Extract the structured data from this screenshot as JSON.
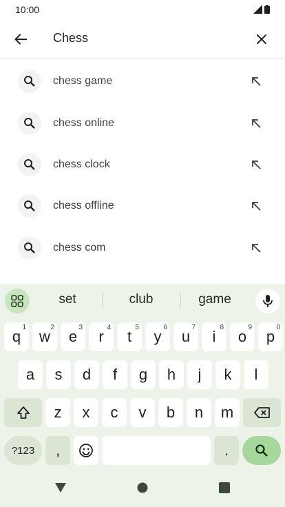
{
  "status_bar": {
    "time": "10:00"
  },
  "search": {
    "query": "Chess"
  },
  "suggestions": [
    {
      "text": "chess game"
    },
    {
      "text": "chess online"
    },
    {
      "text": "chess clock"
    },
    {
      "text": "chess offline"
    },
    {
      "text": "chess com"
    }
  ],
  "keyboard": {
    "suggestions": [
      "set",
      "club",
      "game"
    ],
    "row1": [
      {
        "key": "q",
        "alt": "1"
      },
      {
        "key": "w",
        "alt": "2"
      },
      {
        "key": "e",
        "alt": "3"
      },
      {
        "key": "r",
        "alt": "4"
      },
      {
        "key": "t",
        "alt": "5"
      },
      {
        "key": "y",
        "alt": "6"
      },
      {
        "key": "u",
        "alt": "7"
      },
      {
        "key": "i",
        "alt": "8"
      },
      {
        "key": "o",
        "alt": "9"
      },
      {
        "key": "p",
        "alt": "0"
      }
    ],
    "row2": [
      "a",
      "s",
      "d",
      "f",
      "g",
      "h",
      "j",
      "k",
      "l"
    ],
    "row3": [
      "z",
      "x",
      "c",
      "v",
      "b",
      "n",
      "m"
    ],
    "symbols_label": "?123",
    "comma": ",",
    "period": "."
  },
  "colors": {
    "keyboard_bg": "#eef3e9",
    "action_key": "#a5d89a",
    "modifier_key": "#dbe5d4"
  }
}
